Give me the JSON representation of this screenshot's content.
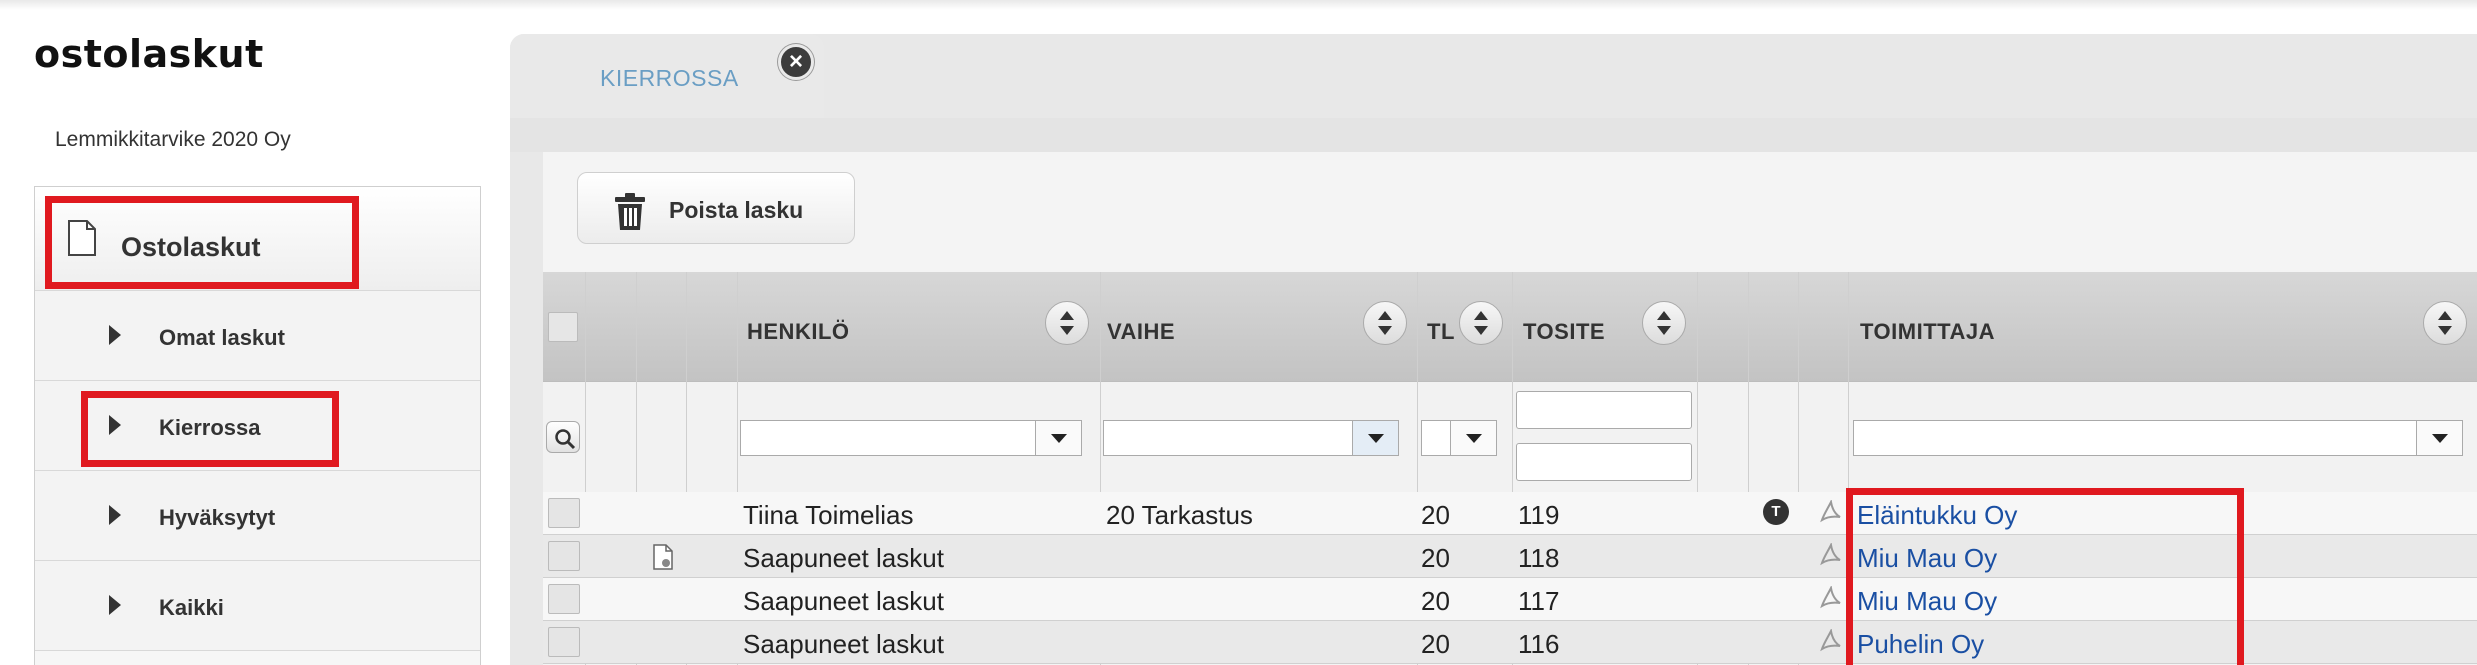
{
  "app": {
    "title": "ostolaskut",
    "company": "Lemmikkitarvike 2020 Oy"
  },
  "sidebar": {
    "header": {
      "label": "Ostolaskut",
      "icon": "document-icon"
    },
    "items": [
      {
        "label": "Omat laskut"
      },
      {
        "label": "Kierrossa"
      },
      {
        "label": "Hyväksytyt"
      },
      {
        "label": "Kaikki"
      }
    ]
  },
  "tab": {
    "label": "KIERROSSA",
    "close_icon": "close-icon"
  },
  "toolbar": {
    "delete_label": "Poista lasku",
    "delete_icon": "trash-icon"
  },
  "table": {
    "columns": {
      "henkilo": "HENKILÖ",
      "vaihe": "VAIHE",
      "tl": "TL",
      "tosite": "TOSITE",
      "toimittaja": "TOIMITTAJA"
    },
    "filters": {
      "henkilo": "",
      "vaihe": "",
      "tl": "",
      "tosite_from": "",
      "tosite_to": "",
      "toimittaja": ""
    },
    "rows": [
      {
        "henkilo": "Tiina Toimelias",
        "vaihe": "20 Tarkastus",
        "tl": "20",
        "tosite": "119",
        "toimittaja": "Eläintukku Oy",
        "t_badge": "T"
      },
      {
        "henkilo": "Saapuneet laskut",
        "vaihe": "",
        "tl": "20",
        "tosite": "118",
        "toimittaja": "Miu Mau Oy",
        "t_badge": ""
      },
      {
        "henkilo": "Saapuneet laskut",
        "vaihe": "",
        "tl": "20",
        "tosite": "117",
        "toimittaja": "Miu Mau Oy",
        "t_badge": ""
      },
      {
        "henkilo": "Saapuneet laskut",
        "vaihe": "",
        "tl": "20",
        "tosite": "116",
        "toimittaja": "Puhelin Oy",
        "t_badge": ""
      }
    ]
  },
  "colors": {
    "highlight": "#e0191f",
    "link": "#1a4fa3",
    "tab_text": "#6a9ec4"
  }
}
